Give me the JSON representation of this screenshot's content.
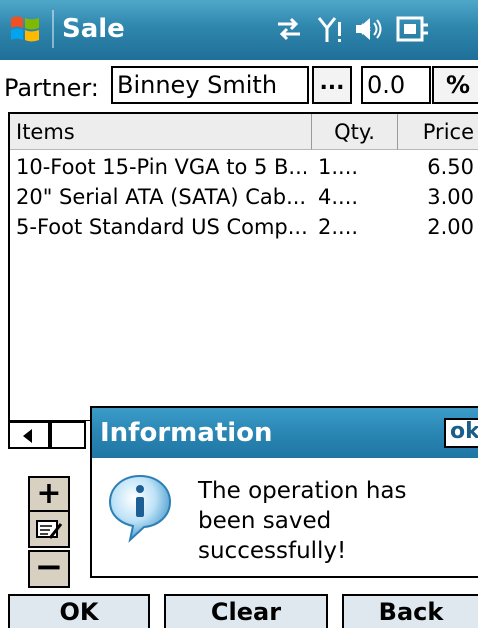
{
  "app": {
    "title": "Sale"
  },
  "status_icons": [
    "connectivity-icon",
    "signal-icon",
    "volume-icon",
    "battery-icon"
  ],
  "partner": {
    "label": "Partner:",
    "value": "Binney  Smith",
    "browse_label": "...",
    "discount_value": "0.0",
    "percent_label": "%"
  },
  "table": {
    "columns": [
      "Items",
      "Qty.",
      "Price"
    ],
    "rows": [
      {
        "item": "10-Foot 15-Pin VGA to 5 B...",
        "qty": "1....",
        "price": "6.50"
      },
      {
        "item": "20\" Serial ATA (SATA) Cab...",
        "qty": "4....",
        "price": "3.00"
      },
      {
        "item": "5-Foot Standard US Comp...",
        "qty": "2....",
        "price": "2.00"
      }
    ]
  },
  "side_buttons": {
    "add": "+",
    "remove": "−"
  },
  "dialog": {
    "title": "Information",
    "ok_label": "ok",
    "message": "The operation has been saved successfully!"
  },
  "buttons": {
    "ok": "OK",
    "clear": "Clear",
    "back": "Back"
  },
  "colors": {
    "title_bar": "#2f86ad",
    "dialog_title": "#2a86b4",
    "button_bg": "#dfe8ee",
    "side_button_bg": "#d8d0c0"
  }
}
